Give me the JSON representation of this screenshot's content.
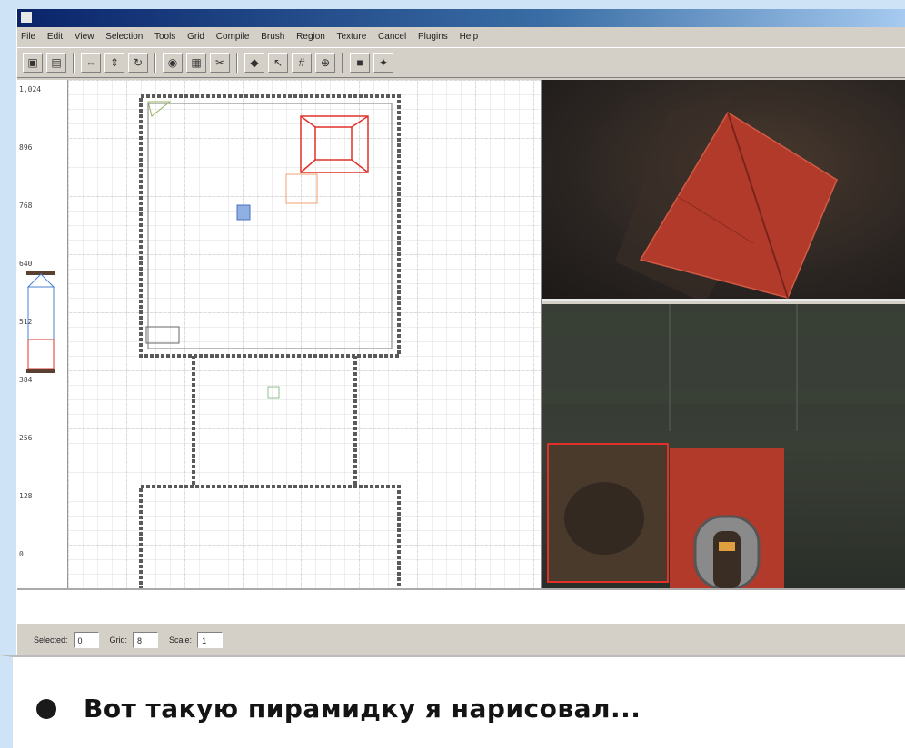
{
  "window": {
    "title": "",
    "menu": [
      "File",
      "Edit",
      "View",
      "Selection",
      "Tools",
      "Grid",
      "Compile",
      "Brush",
      "Region",
      "Texture",
      "Cancel",
      "Plugins",
      "Help"
    ]
  },
  "toolbar": {
    "buttons": [
      "save-icon",
      "open-icon",
      "flip-x-icon",
      "flip-y-icon",
      "rotate-icon",
      "camera-icon",
      "texture-icon",
      "clipper-icon",
      "entity-icon",
      "select-icon"
    ]
  },
  "ruler": {
    "ticks": [
      "1,024",
      "896",
      "768",
      "640",
      "512",
      "384",
      "256",
      "128",
      "0"
    ]
  },
  "statusbar": {
    "fields": [
      {
        "label": "Selected:",
        "value": "0"
      },
      {
        "label": "Grid:",
        "value": "8"
      },
      {
        "label": "Scale:",
        "value": "1"
      }
    ]
  },
  "colors": {
    "selection": "#e0302a",
    "grid_minor": "#d8d8d8",
    "grid_major": "#b5b5b5",
    "brush_outline": "#5a5a5a",
    "texture_red": "#b13a2b"
  },
  "caption": {
    "text": "Вот такую пирамидку я нарисовал..."
  }
}
